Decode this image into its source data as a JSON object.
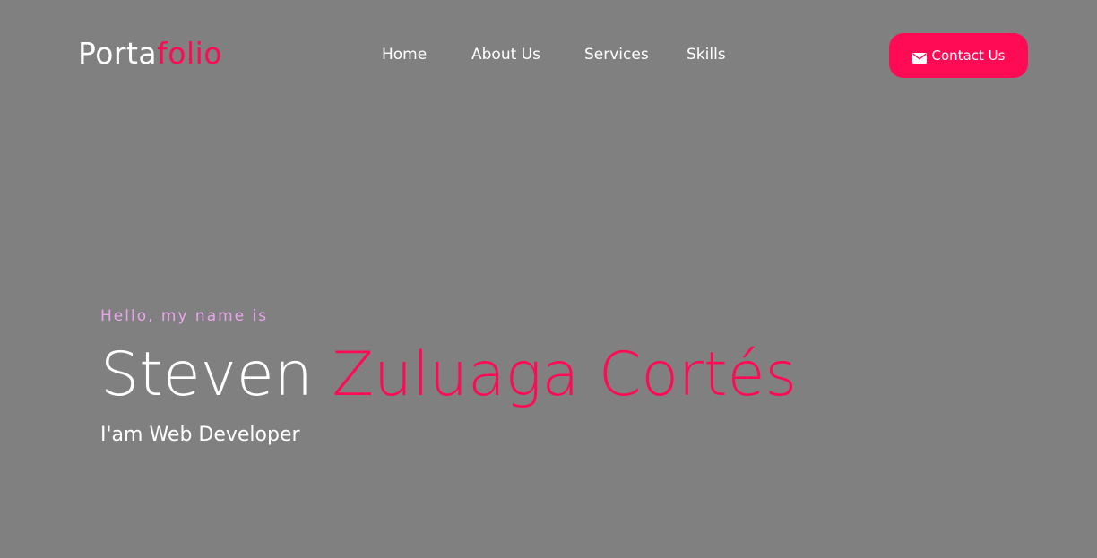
{
  "nav": {
    "logo": {
      "part1": "Porta",
      "part2": "folio"
    },
    "links": [
      "Home",
      "About Us",
      "Services",
      "Skills"
    ],
    "contact_button": {
      "label": "Contact Us",
      "icon": "envelope-icon"
    }
  },
  "hero": {
    "greeting": "Hello, my name is",
    "first_name": "Steven",
    "last_name": "Zuluaga Cortés",
    "role": "I'am Web Developer"
  },
  "colors": {
    "background": "#808080",
    "accent": "#ff0a54",
    "greeting": "#e7a6e8",
    "text": "#ffffff"
  }
}
